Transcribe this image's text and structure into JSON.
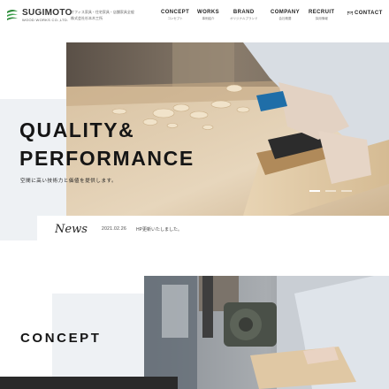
{
  "brand": {
    "name": "SUGIMOTO",
    "sub": "WOOD WORKS CO.,LTD.",
    "tagline": [
      "オフィス家具・住宅家具・店舗家具全般",
      "株式会社杉本木工所"
    ]
  },
  "nav": {
    "items": [
      {
        "en": "CONCEPT",
        "jp": "コンセプト"
      },
      {
        "en": "WORKS",
        "jp": "事例紹介"
      },
      {
        "en": "BRAND",
        "jp": "オリジナルブランド"
      },
      {
        "en": "COMPANY",
        "jp": "会社概要"
      },
      {
        "en": "RECRUIT",
        "jp": "採用情報"
      }
    ],
    "contact": "CONTACT"
  },
  "hero": {
    "title_line1": "QUALITY&",
    "title_line2": "PERFORMANCE",
    "subtitle": "空間に高い技術力と価値を提供します。",
    "slides": 3,
    "active_slide": 1
  },
  "news": {
    "label": "News",
    "date": "2021.02.26",
    "text": "HP更新いたしました。"
  },
  "concept": {
    "title": "CONCEPT"
  },
  "colors": {
    "brand_green": "#2e8b3a",
    "text_dark": "#151515",
    "panel_gray": "#eef1f4",
    "footer_dark": "#2a2a2a"
  }
}
